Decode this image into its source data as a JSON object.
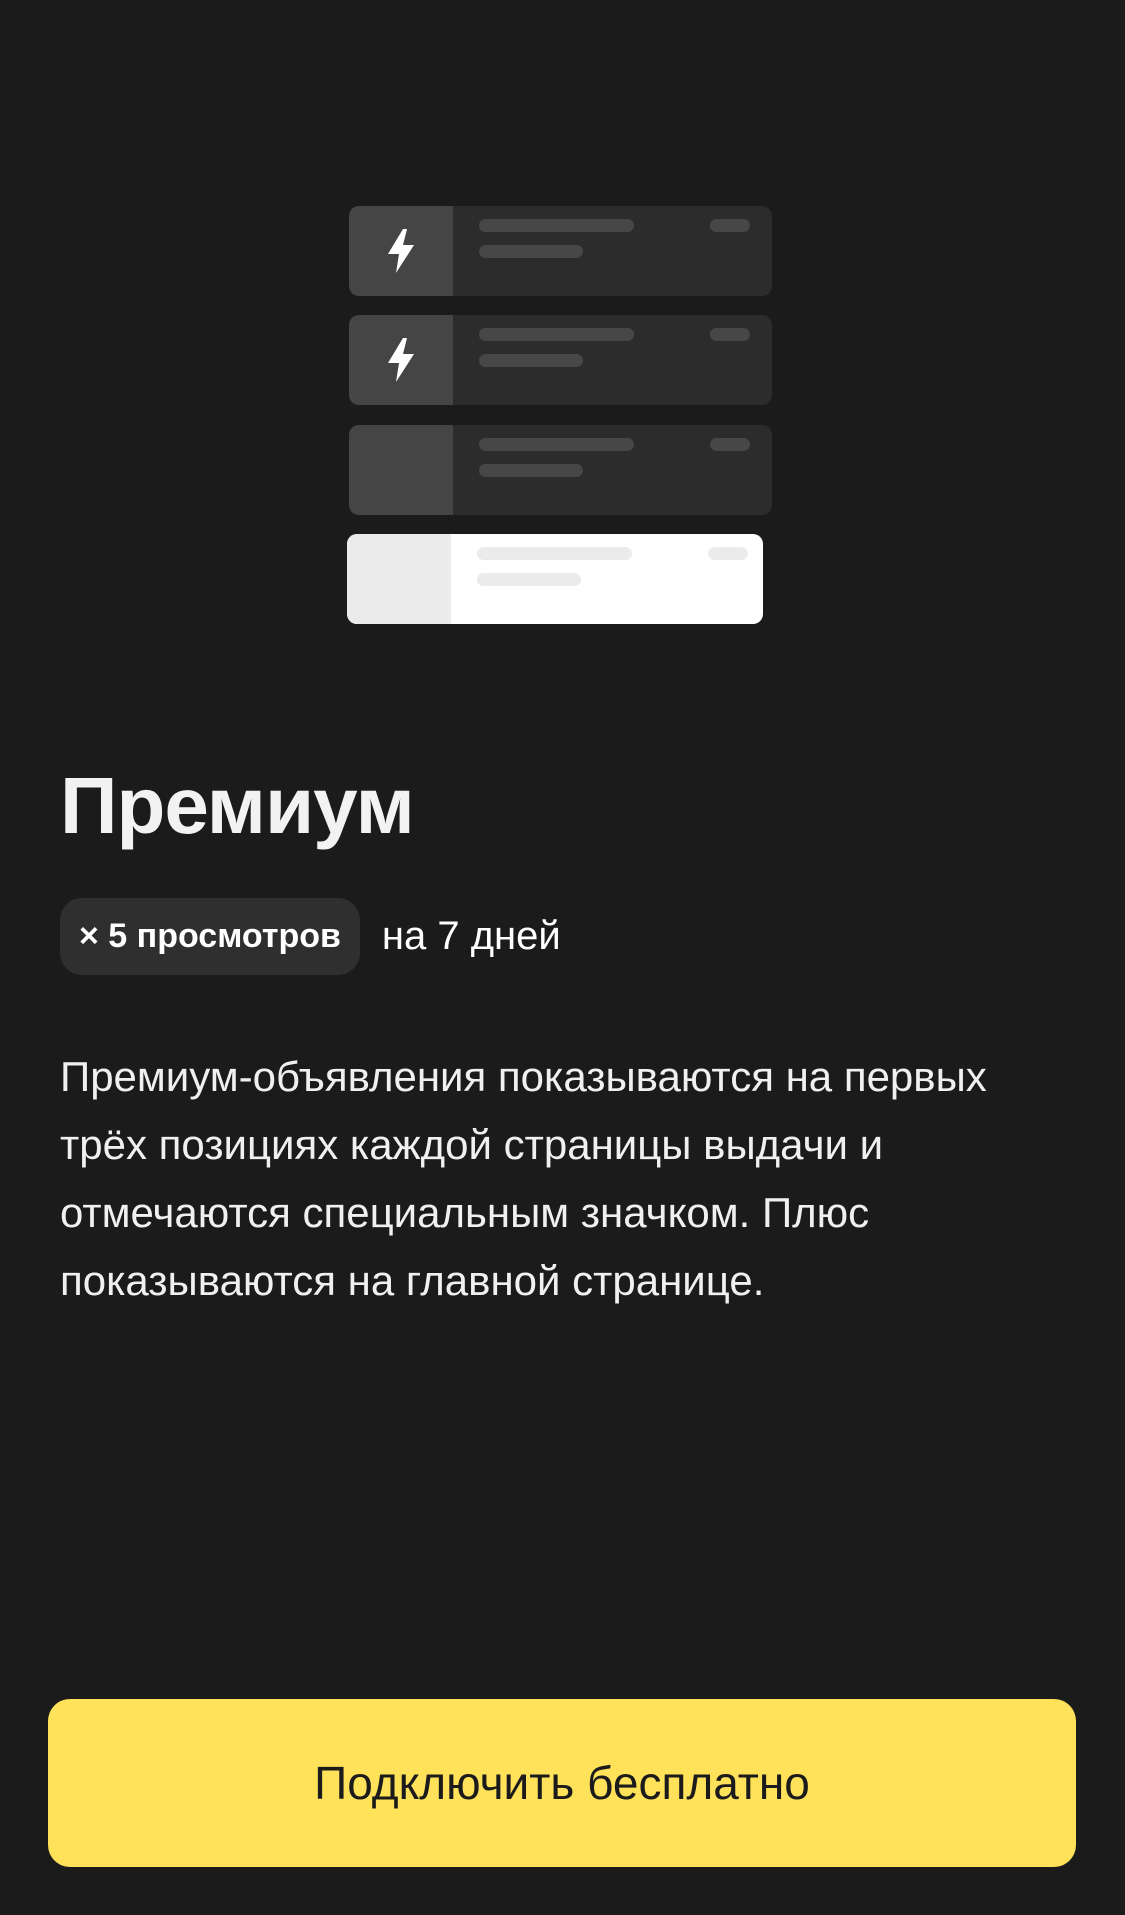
{
  "illustration": {
    "cards": [
      {
        "icon": "lightning-icon"
      },
      {
        "icon": "lightning-icon"
      },
      {
        "icon": null
      },
      {
        "icon": null,
        "highlighted": true
      }
    ]
  },
  "title": "Премиум",
  "tag": {
    "label": "× 5 просмотров",
    "suffix": "на 7 дней"
  },
  "description": "Премиум-объявления показываются на первых трёх позициях каждой страницы выдачи и отмечаются специальным значком. Плюс показываются на главной странице.",
  "cta": {
    "label": "Подключить бесплатно"
  },
  "colors": {
    "background": "#1b1b1b",
    "accent": "#ffe15a",
    "card": "#2c2c2c",
    "tag": "#2f2f2f"
  }
}
